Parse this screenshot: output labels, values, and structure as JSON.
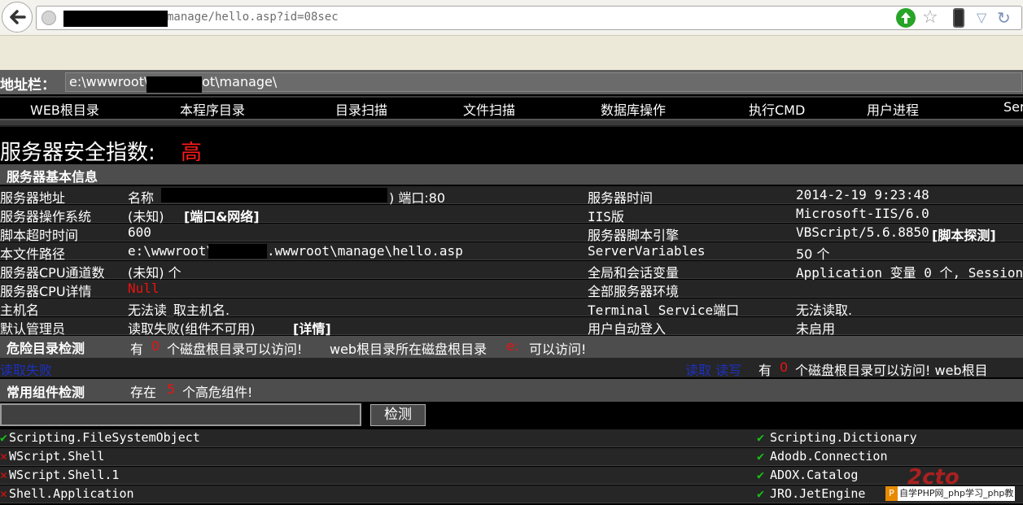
{
  "browser": {
    "url": "manage/hello.asp?id=08sec",
    "star_icon": "star-outline",
    "go_icon": "green-arrow",
    "reload_icon": "reload"
  },
  "address": {
    "label": "地址栏：",
    "value": "e:\\wwwroot\\          \\wwwroot\\manage\\"
  },
  "nav": {
    "items": [
      "WEB根目录",
      "本程序目录",
      "目录扫描",
      "文件扫描",
      "数据库操作",
      "执行CMD",
      "用户进程",
      "Ser"
    ]
  },
  "security": {
    "label": "服务器安全指数:",
    "level": "高"
  },
  "basic_info": {
    "header": "服务器基本信息",
    "rows": [
      {
        "k1": "服务器地址",
        "v1": "名称",
        "v1b": ") 端口:80",
        "k2": "服务器时间",
        "v2": "2014-2-19 9:23:48"
      },
      {
        "k1": "服务器操作系统",
        "v1": "(未知)",
        "v1b": "[端口&网络]",
        "k2": "IIS版",
        "v2": "Microsoft-IIS/6.0"
      },
      {
        "k1": "脚本超时时间",
        "v1": "600",
        "v1b": "",
        "k2": "服务器脚本引擎",
        "v2": "VBScript/5.6.8850",
        "v2b": "[脚本探测]"
      },
      {
        "k1": "本文件路径",
        "v1": "e:\\wwwroot\\",
        "v1b": ".wwwroot\\manage\\hello.asp",
        "k2": "ServerVariables",
        "v2": "50 个"
      },
      {
        "k1": "服务器CPU通道数",
        "v1": "(未知) 个",
        "v1b": "",
        "k2": "全局和会话变量",
        "v2": "Application 变量 0 个, Session"
      },
      {
        "k1": "服务器CPU详情",
        "v1": "Null",
        "v1b": "",
        "k2": "全部服务器环境",
        "v2": ""
      },
      {
        "k1": "主机名",
        "v1": "无法读_取主机名.",
        "v1b": "",
        "k2": "Terminal Service端口",
        "v2": "无法读取."
      },
      {
        "k1": "默认管理员",
        "v1": "读取失败(组件不可用)",
        "v1b": "[详情]",
        "k2": "用户自动登入",
        "v2": "未启用"
      }
    ]
  },
  "danger": {
    "header": "危险目录检测",
    "summary_pre": "有",
    "summary_count": "0",
    "summary_mid": "个磁盘根目录可以访问!",
    "summary_web": "web根目录所在磁盘根目录",
    "summary_drive": "e:",
    "summary_post": "可以访问!",
    "row2_left": "读取失败",
    "row2_links": "读取 读写",
    "row2_pre": "有",
    "row2_count": "0",
    "row2_text": "个磁盘根目录可以访问! web根目"
  },
  "components": {
    "header": "常用组件检测",
    "summary_pre": "存在",
    "summary_count": "5",
    "summary_post": "个高危组件!",
    "check_button": "检测",
    "left": [
      {
        "name": "Scripting.FileSystemObject",
        "ok": true
      },
      {
        "name": "WScript.Shell",
        "ok": false
      },
      {
        "name": "WScript.Shell.1",
        "ok": false
      },
      {
        "name": "Shell.Application",
        "ok": false
      }
    ],
    "right": [
      {
        "name": "Scripting.Dictionary",
        "ok": true
      },
      {
        "name": "Adodb.Connection",
        "ok": true
      },
      {
        "name": "ADOX.Catalog",
        "ok": true
      },
      {
        "name": "JRO.JetEngine",
        "ok": true
      }
    ]
  },
  "watermark": {
    "logo": "2cto",
    "text": "自学PHP网_php学习_php教"
  }
}
